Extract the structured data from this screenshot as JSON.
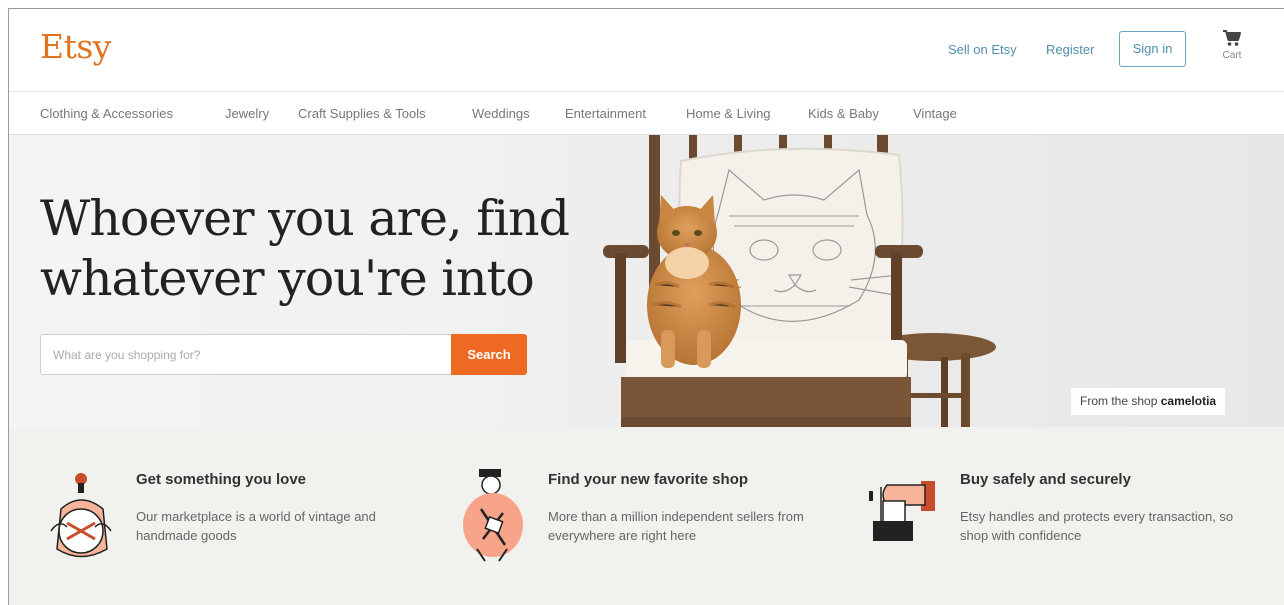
{
  "header": {
    "logo": "Etsy",
    "sell_label": "Sell on Etsy",
    "register_label": "Register",
    "signin_label": "Sign in",
    "cart_label": "Cart"
  },
  "nav": {
    "items": [
      "Clothing & Accessories",
      "Jewelry",
      "Craft Supplies & Tools",
      "Weddings",
      "Entertainment",
      "Home & Living",
      "Kids & Baby",
      "Vintage"
    ]
  },
  "hero": {
    "headline_line1": "Whoever you are, find",
    "headline_line2": "whatever you're into",
    "search_placeholder": "What are you shopping for?",
    "search_button": "Search",
    "credit_prefix": "From the shop",
    "credit_shop": "camelotia"
  },
  "features": [
    {
      "title": "Get something you love",
      "desc": "Our marketplace is a world of vintage and handmade goods",
      "icon": "person-with-gift-icon"
    },
    {
      "title": "Find your new favorite shop",
      "desc": "More than a million independent sellers from everywhere are right here",
      "icon": "seller-crafting-icon"
    },
    {
      "title": "Buy safely and securely",
      "desc": "Etsy handles and protects every transaction, so shop with confidence",
      "icon": "secure-handoff-icon"
    }
  ],
  "colors": {
    "brand": "#e1731f",
    "search_button": "#ee6a23",
    "link": "#4f8fae",
    "features_bg": "#f1f1ee"
  }
}
